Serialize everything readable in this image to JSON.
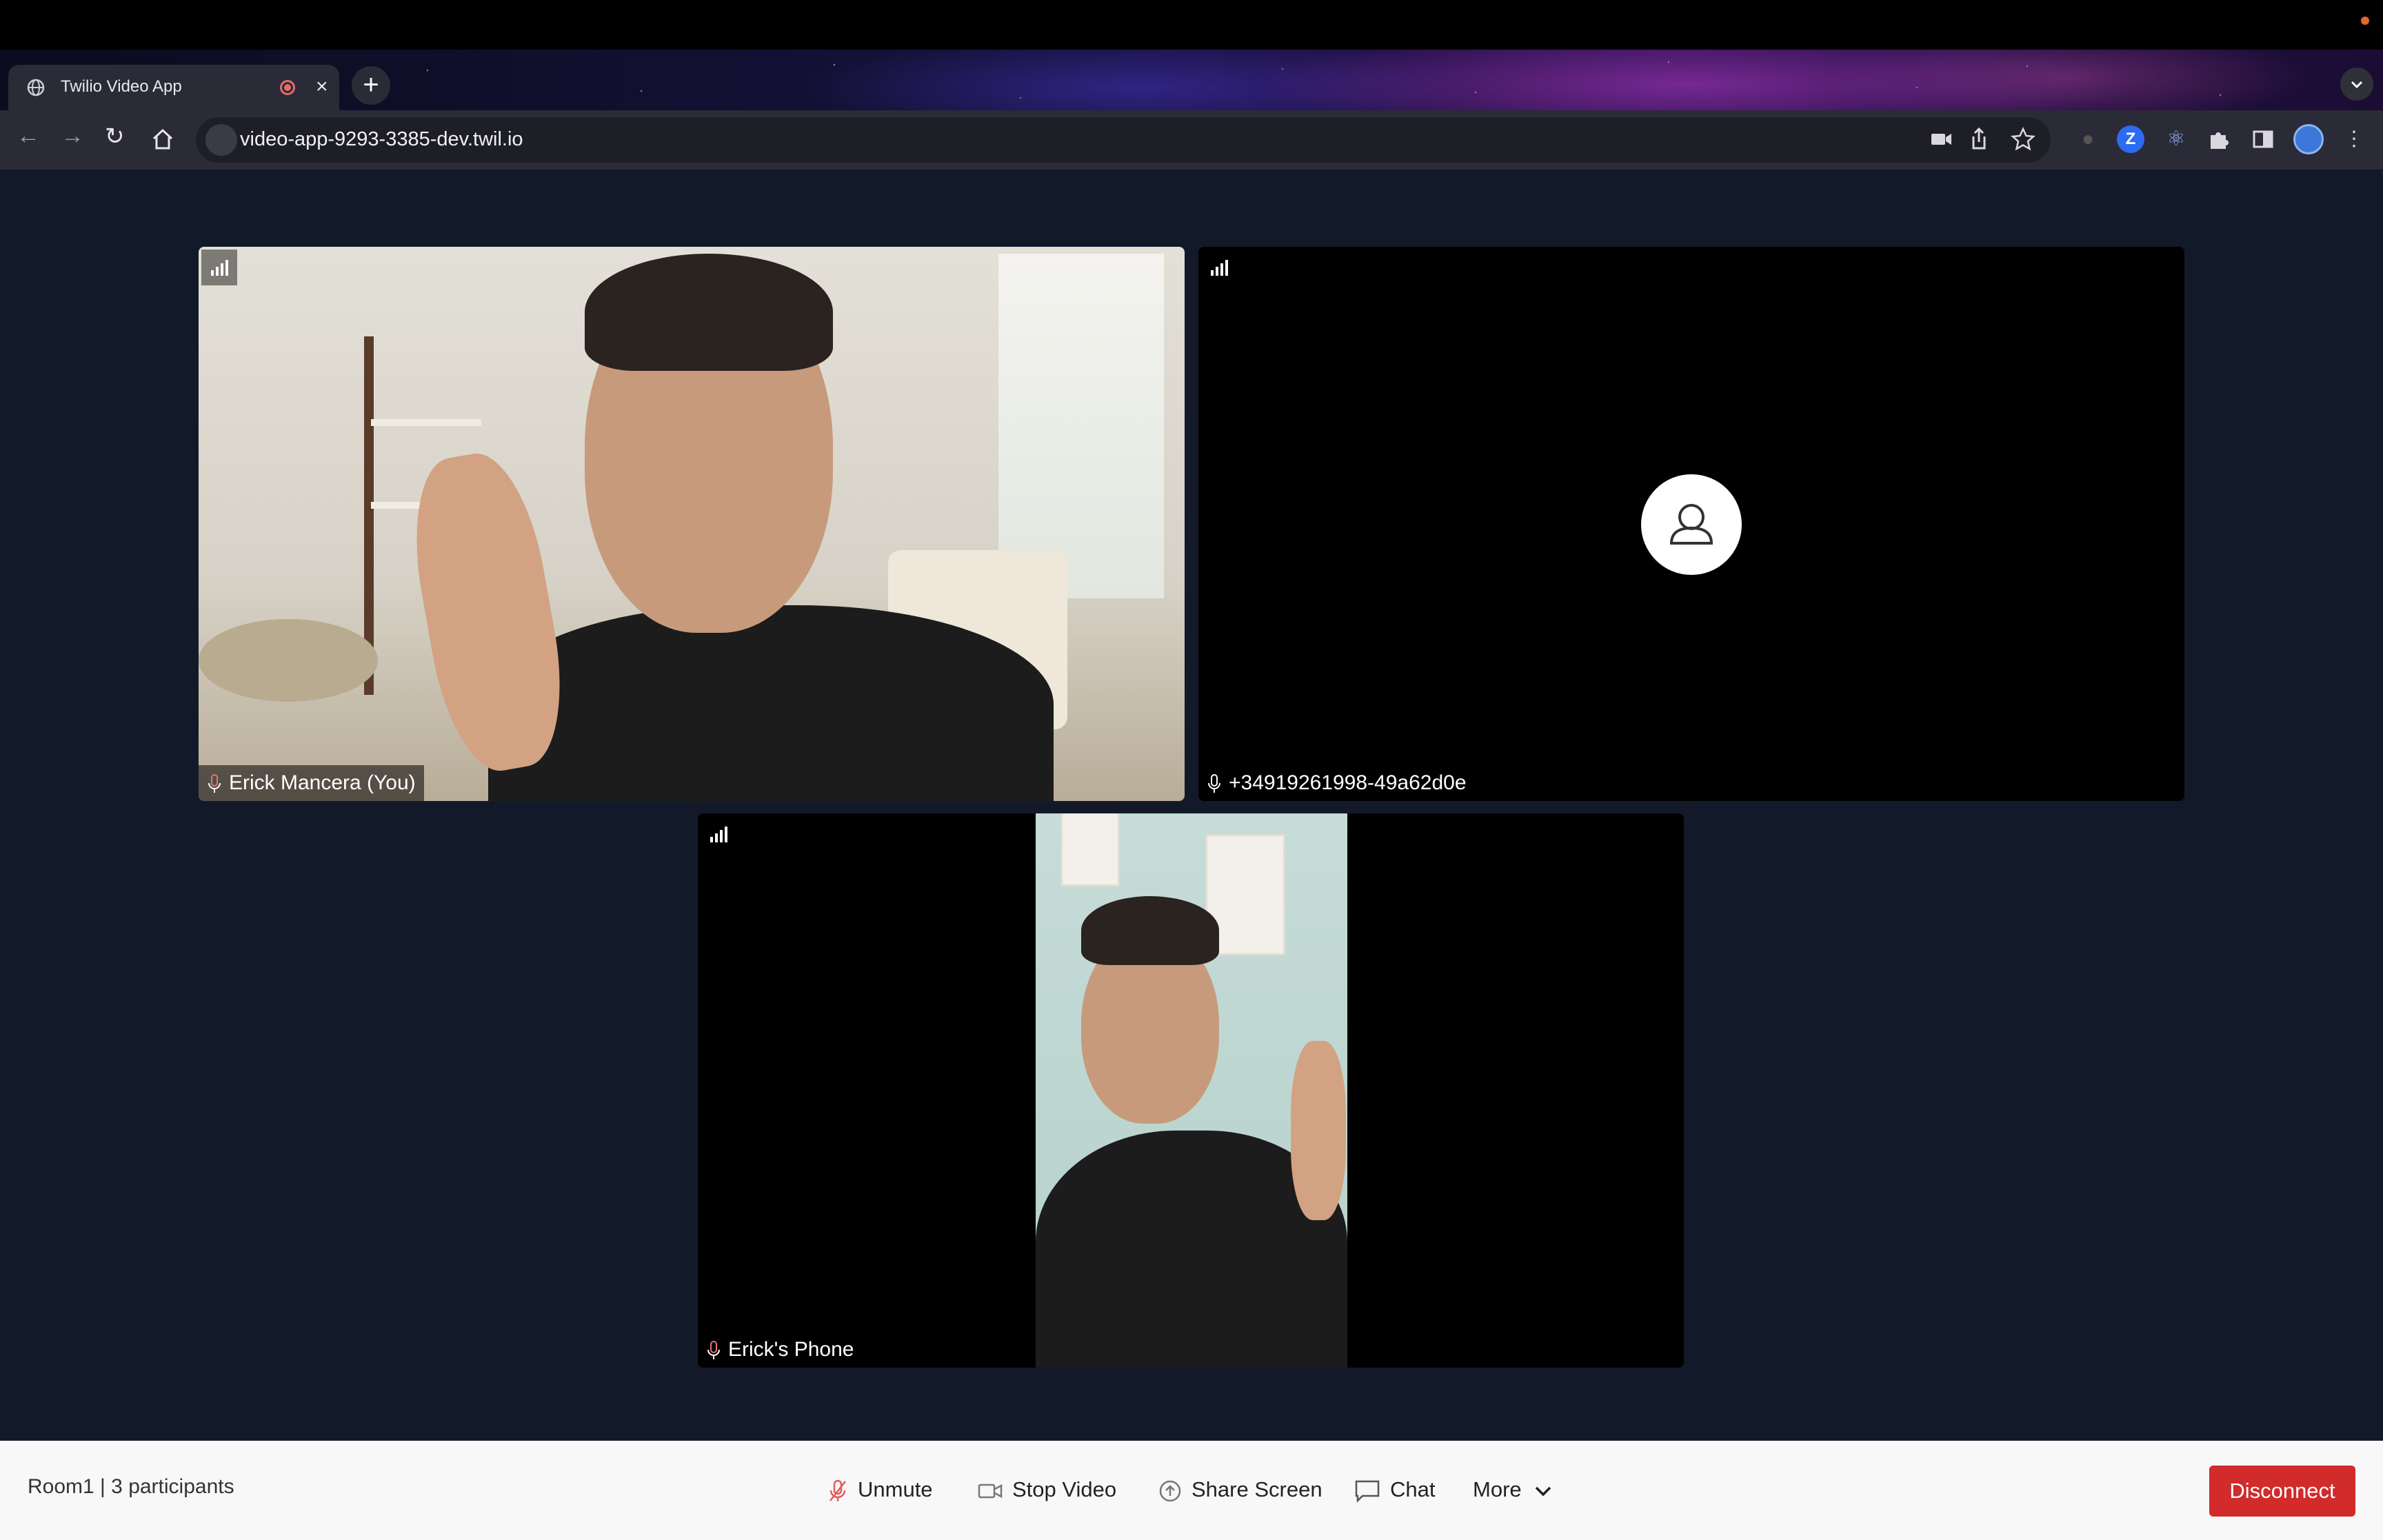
{
  "browser": {
    "tab_title": "Twilio Video App",
    "url": "video-app-9293-3385-dev.twil.io",
    "new_tab_symbol": "+",
    "tab_close_symbol": "×"
  },
  "participants": {
    "local": {
      "name": "Erick Mancera (You)"
    },
    "remote_phone_number": {
      "name": "+34919261998-49a62d0e"
    },
    "phone": {
      "name": "Erick's Phone"
    }
  },
  "footer": {
    "room_info": "Room1 | 3 participants",
    "unmute_label": "Unmute",
    "stop_video_label": "Stop Video",
    "share_screen_label": "Share Screen",
    "chat_label": "Chat",
    "more_label": "More",
    "disconnect_label": "Disconnect"
  },
  "colors": {
    "page_background": "#121a2a",
    "disconnect": "#d12b2b",
    "footer_background": "#f8f8f8"
  },
  "icons": [
    "globe-icon",
    "recording-icon",
    "close-icon",
    "plus-icon",
    "back-icon",
    "forward-icon",
    "reload-icon",
    "home-icon",
    "site-settings-icon",
    "camera-icon",
    "share-icon",
    "star-icon",
    "extension-z-icon",
    "react-icon",
    "puzzle-icon",
    "sidepanel-icon",
    "profile-icon",
    "kebab-menu-icon",
    "signal-icon",
    "mic-icon",
    "mic-off-icon",
    "avatar-icon",
    "video-icon",
    "share-screen-icon",
    "chat-icon",
    "chevron-down-icon"
  ]
}
